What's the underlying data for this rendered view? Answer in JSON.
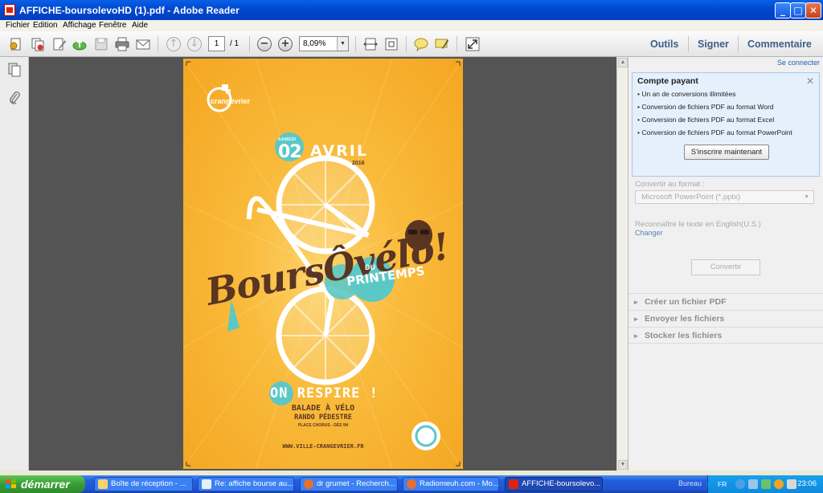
{
  "window": {
    "title": "AFFICHE-boursolevoHD (1).pdf - Adobe Reader",
    "controls": {
      "minimize": "_",
      "maximize": "□",
      "close": "✕"
    }
  },
  "menu": [
    "Fichier",
    "Edition",
    "Affichage",
    "Fenêtre",
    "Aide"
  ],
  "toolbar": {
    "page_current": "1",
    "page_total": "/ 1",
    "zoom": "8,09%",
    "right_links": [
      "Outils",
      "Signer",
      "Commentaire"
    ]
  },
  "poster": {
    "brand": "crangevrier",
    "day_label": "SAMEDI",
    "day": "02",
    "month": "AVRIL",
    "year": "2016",
    "title_main": "BoursÔvélo!",
    "title_du": "DU",
    "title_printemps": "PRINTEMPS",
    "tagline": "ON RESPIRE !",
    "line1": "BALADE À VÉLO",
    "line2": "RANDO PÉDESTRE",
    "line3": "PLACE CHORUS - DÈS 9H",
    "url": "WWW.VILLE-CRANGEVRIER.FR"
  },
  "panel": {
    "se_connecter": "Se connecter",
    "promo_title": "Compte payant",
    "promo_items": [
      "Un an de conversions illimitées",
      "Conversion de fichiers PDF au format Word",
      "Conversion de fichiers PDF au format Excel",
      "Conversion de fichiers PDF au format PowerPoint"
    ],
    "promo_button": "S'inscrire maintenant",
    "convert_label": "Convertir au format :",
    "convert_value": "Microsoft PowerPoint (*.pptx)",
    "recognize": "Reconnaître le texte en English(U.S.)",
    "change": "Changer",
    "convert_button": "Convertir",
    "sections": [
      "Créer un fichier PDF",
      "Envoyer les fichiers",
      "Stocker les fichiers"
    ]
  },
  "taskbar": {
    "start": "démarrer",
    "tasks": [
      "Boîte de réception - ...",
      "Re: affiche bourse au...",
      "dr grumet - Recherch...",
      "Radiomeuh.com - Mo...",
      "AFFICHE-boursolevo..."
    ],
    "bureau": "Bureau",
    "lang": "FR",
    "clock": "23:06"
  },
  "colors": {
    "poster_yellow": "#f7b42e",
    "poster_teal": "#5cc8c6",
    "poster_brown": "#5a3522",
    "titlebar_blue": "#0a5fe8",
    "start_green": "#3a9c36"
  }
}
